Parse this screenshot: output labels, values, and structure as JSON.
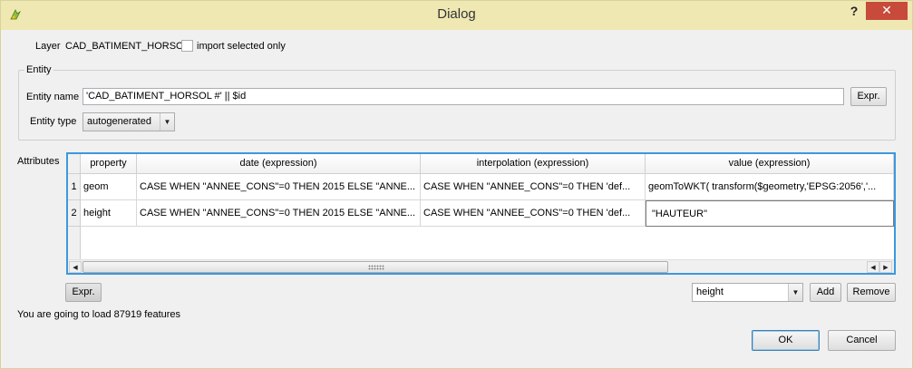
{
  "window": {
    "title": "Dialog",
    "help_label": "?",
    "close_label": "✕",
    "accent_close": "#c74a3a"
  },
  "layer": {
    "label": "Layer",
    "name": "CAD_BATIMENT_HORSOL",
    "import_selected_label": "import selected only",
    "import_selected_checked": false
  },
  "entity": {
    "group_title": "Entity",
    "name_label": "Entity name",
    "name_value": "'CAD_BATIMENT_HORSOL #' || $id",
    "expr_button": "Expr.",
    "type_label": "Entity type",
    "type_value": "autogenerated"
  },
  "attributes": {
    "label": "Attributes",
    "columns": [
      "property",
      "date (expression)",
      "interpolation  (expression)",
      "value  (expression)"
    ],
    "rows": [
      {
        "num": "1",
        "property": "geom",
        "date": "CASE WHEN \"ANNEE_CONS\"=0 THEN 2015 ELSE \"ANNE...",
        "interpolation": "CASE WHEN \"ANNEE_CONS\"=0 THEN 'def...",
        "value": "geomToWKT( transform($geometry,'EPSG:2056','..."
      },
      {
        "num": "2",
        "property": "height",
        "date": "CASE WHEN \"ANNEE_CONS\"=0 THEN 2015 ELSE \"ANNE...",
        "interpolation": "CASE WHEN \"ANNEE_CONS\"=0 THEN 'def...",
        "value": "\"HAUTEUR\""
      }
    ]
  },
  "bottom": {
    "expr_button": "Expr.",
    "attribute_select": "height",
    "add_button": "Add",
    "remove_button": "Remove",
    "status": "You are going to load 87919 features",
    "ok_button": "OK",
    "cancel_button": "Cancel"
  }
}
